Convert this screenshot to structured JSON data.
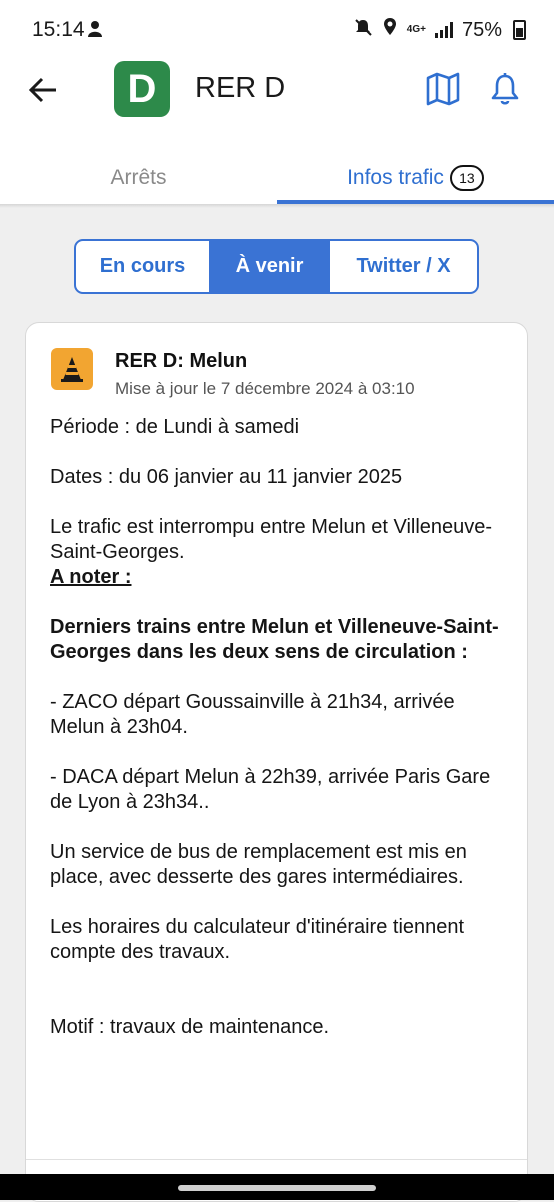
{
  "status_bar": {
    "time": "15:14",
    "network": "4G+",
    "battery": "75%"
  },
  "header": {
    "line_badge": "D",
    "line_badge_color": "#2d8a4a",
    "title": "RER D",
    "icons": [
      "back-arrow-icon",
      "map-icon",
      "bell-icon"
    ]
  },
  "tabs": {
    "stops_label": "Arrêts",
    "traffic_label": "Infos trafic",
    "traffic_count": "13",
    "accent": "#3a73d4"
  },
  "segments": {
    "current": "En cours",
    "upcoming": "À venir",
    "twitter": "Twitter / X",
    "selected": "À venir"
  },
  "card": {
    "title": "RER D: Melun",
    "updated": "Mise à jour le 7 décembre 2024 à 03:10",
    "period": "Période : de Lundi à samedi",
    "dates": "Dates : du 06 janvier au 11 janvier 2025",
    "interruption": "Le trafic est interrompu entre Melun et Villeneuve-Saint-Georges.",
    "note_heading": "A noter :",
    "last_trains_heading": "Derniers trains entre Melun et Villeneuve-Saint-Georges dans les deux sens de circulation :",
    "train_zaco": "- ZACO départ Goussainville à 21h34, arrivée Melun à 23h04.",
    "train_daca": "- DACA départ Melun à 22h39, arrivée Paris Gare de Lyon à 23h34..",
    "bus_service": "Un service de bus de remplacement est mis en place, avec desserte des gares intermédiaires.",
    "schedules": "Les horaires du calculateur d'itinéraire tiennent compte des travaux.",
    "reason": "Motif : travaux de maintenance.",
    "icon": "traffic-cone-icon",
    "icon_color": "#f2a531"
  }
}
